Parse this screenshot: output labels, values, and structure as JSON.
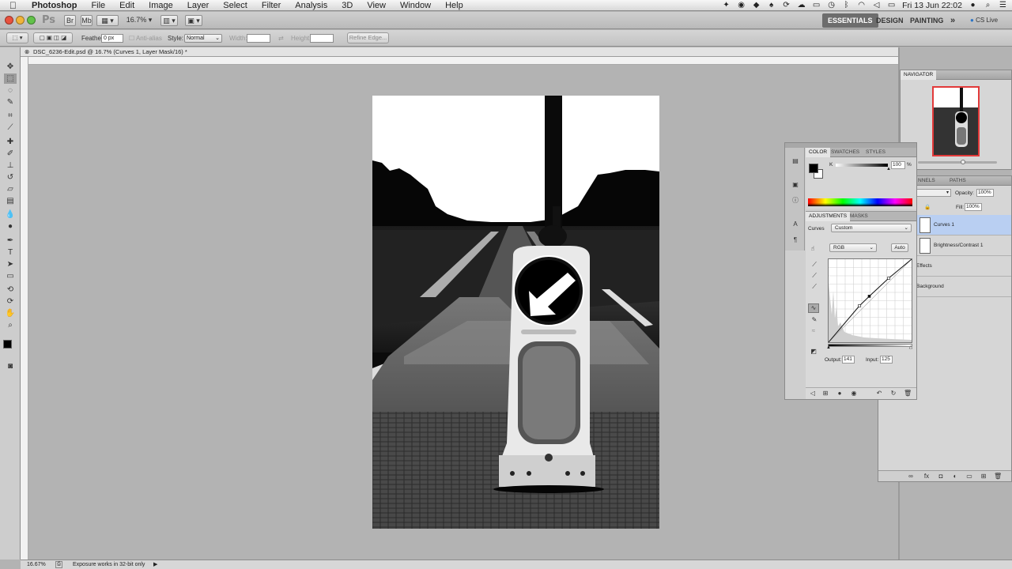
{
  "menubar": {
    "app_name": "Photoshop",
    "menus": [
      "File",
      "Edit",
      "Image",
      "Layer",
      "Select",
      "Filter",
      "Analysis",
      "3D",
      "View",
      "Window",
      "Help"
    ],
    "clock": "Fri 13 Jun  22:02"
  },
  "appbar": {
    "ps_badge": "Ps",
    "br_badge": "Br",
    "mb_badge": "Mb",
    "zoom": "16.7%",
    "workspaces": [
      "ESSENTIALS",
      "DESIGN",
      "PAINTING"
    ],
    "more": "»",
    "cs_live": "CS Live"
  },
  "options": {
    "feather_label": "Feather:",
    "feather_value": "0 px",
    "antialias_label": "Anti-alias",
    "style_label": "Style:",
    "style_value": "Normal",
    "width_label": "Width:",
    "height_label": "Height:",
    "refine_label": "Refine Edge..."
  },
  "document": {
    "tab_title": "DSC_6236-Edit.psd @ 16.7% (Curves 1, Layer Mask/16) *"
  },
  "status": {
    "zoom": "16.67%",
    "message": "Exposure works in 32-bit only"
  },
  "navigator": {
    "tab": "NAVIGATOR"
  },
  "color_panel": {
    "tabs": [
      "COLOR",
      "SWATCHES",
      "STYLES"
    ],
    "channel": "K",
    "value": "100",
    "unit": "%"
  },
  "adjustments": {
    "tabs": [
      "ADJUSTMENTS",
      "MASKS"
    ],
    "type_label": "Curves",
    "preset": "Custom",
    "channel": "RGB",
    "auto_label": "Auto",
    "output_label": "Output:",
    "output_value": "141",
    "input_label": "Input:",
    "input_value": "125",
    "curve_points_input": [
      0,
      95,
      125,
      185,
      255
    ],
    "curve_points_output": [
      0,
      112,
      141,
      197,
      255
    ]
  },
  "layers": {
    "tabs": [
      "CHANNELS",
      "PATHS"
    ],
    "opacity_label": "Opacity:",
    "opacity_value": "100%",
    "fill_label": "Fill:",
    "fill_value": "100%",
    "rows": [
      {
        "name": "Curves 1",
        "selected": true
      },
      {
        "name": "Brightness/Contrast 1",
        "selected": false
      },
      {
        "name": "Effects",
        "selected": false
      },
      {
        "name": "Background",
        "selected": false
      }
    ],
    "channels_tab_visible": "NNELS"
  },
  "colors": {
    "selection_blue": "#b9cff2",
    "ess_bg": "#6d6d6d"
  }
}
